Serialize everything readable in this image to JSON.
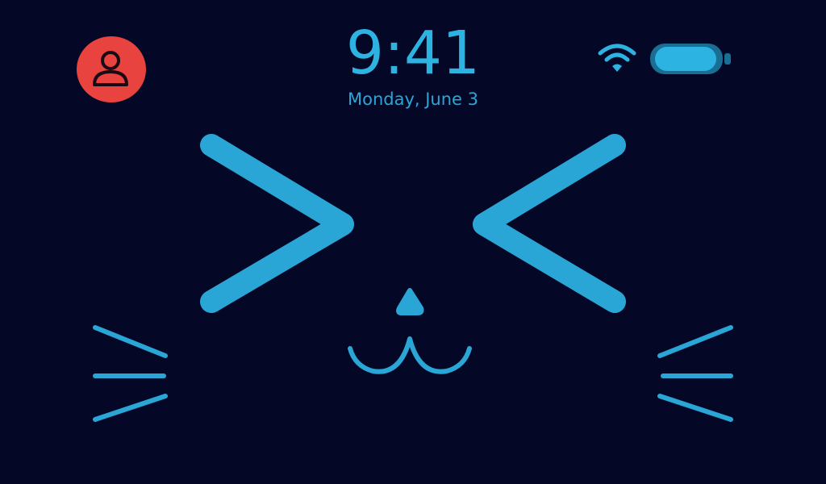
{
  "status_bar": {
    "time": "9:41",
    "date": "Monday, June 3",
    "user_icon": "person-icon",
    "wifi_icon": "wifi-icon",
    "battery_icon": "battery-icon"
  },
  "colors": {
    "background": "#040826",
    "accent": "#2db3e2",
    "battery_body": "#1a6e93",
    "battery_fill": "#2db3e2",
    "avatar_bg": "#e8433e",
    "avatar_fg": "#1a0a16"
  },
  "face": {
    "expression": "happy-squint-cat",
    "left_eye_icon": "chevron-right-eye",
    "right_eye_icon": "chevron-left-eye",
    "nose_icon": "triangle-nose",
    "mouth_icon": "cat-mouth",
    "whisker_icon": "whiskers"
  }
}
